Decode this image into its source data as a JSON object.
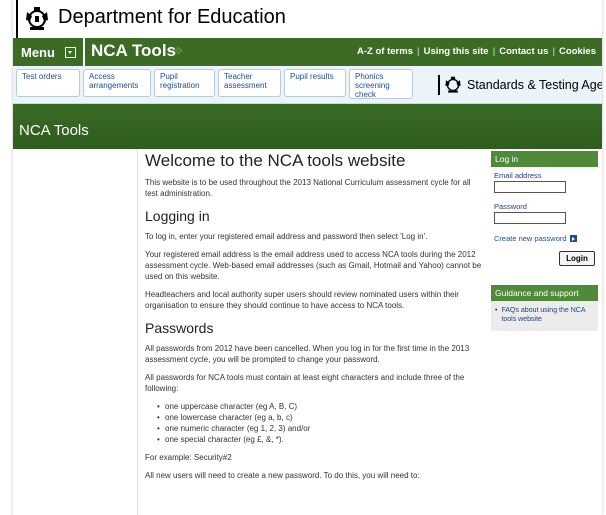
{
  "header": {
    "department": "Department for Education",
    "crest_icon": "royal-crest-icon"
  },
  "nav": {
    "menu_label": "Menu",
    "brand": "NCA Tools",
    "links": [
      "A-Z of terms",
      "Using this site",
      "Contact us",
      "Cookies"
    ]
  },
  "tabs": [
    "Test orders",
    "Access arrangements",
    "Pupil registration",
    "Teacher assessment",
    "Pupil results",
    "Phonics screening check"
  ],
  "sta": {
    "name": "Standards & Testing Agency"
  },
  "banner": {
    "title": "NCA Tools"
  },
  "main": {
    "title": "Welcome to the NCA tools website",
    "intro": "This website is to be used throughout the 2013 National Curriculum assessment cycle for all test administration.",
    "login_heading": "Logging in",
    "login_p1": "To log in, enter your registered email address and password then select 'Log in'.",
    "login_p2": "Your registered email address is the email address used to access NCA tools during the 2012 assessment cycle. Web-based email addresses (such as Gmail, Hotmail and Yahoo) cannot be used on this website.",
    "login_p3": "Headteachers and local authority super users should review nominated users within their organisation to ensure they should continue to have access to NCA tools.",
    "passwords_heading": "Passwords",
    "pw_p1": "All passwords from 2012 have been cancelled. When you log in for the first time in the 2013 assessment cycle, you will be prompted to change your password.",
    "pw_p2": "All passwords for NCA tools must contain at least eight characters and include three of the following:",
    "pw_rules": [
      "one uppercase character (eg A, B, C)",
      "one lowercase character (eg a, b, c)",
      "one numeric character (eg 1, 2, 3) and/or",
      "one special character (eg £, &, *)."
    ],
    "pw_example": "For example: Security#2",
    "pw_new_users": "All new users will need to create a new password. To do this, you will need to:"
  },
  "sidebar": {
    "login_title": "Log in",
    "email_label": "Email address",
    "email_value": "",
    "password_label": "Password",
    "password_value": "",
    "create_password": "Create new password",
    "login_button": "Login",
    "guidance_title": "Guidance and support",
    "guidance_link": "FAQs about using the NCA tools website"
  },
  "colors": {
    "nav_green": "#3b6b25",
    "panel_green": "#4f8a3a",
    "link_blue": "#1f4c99"
  }
}
